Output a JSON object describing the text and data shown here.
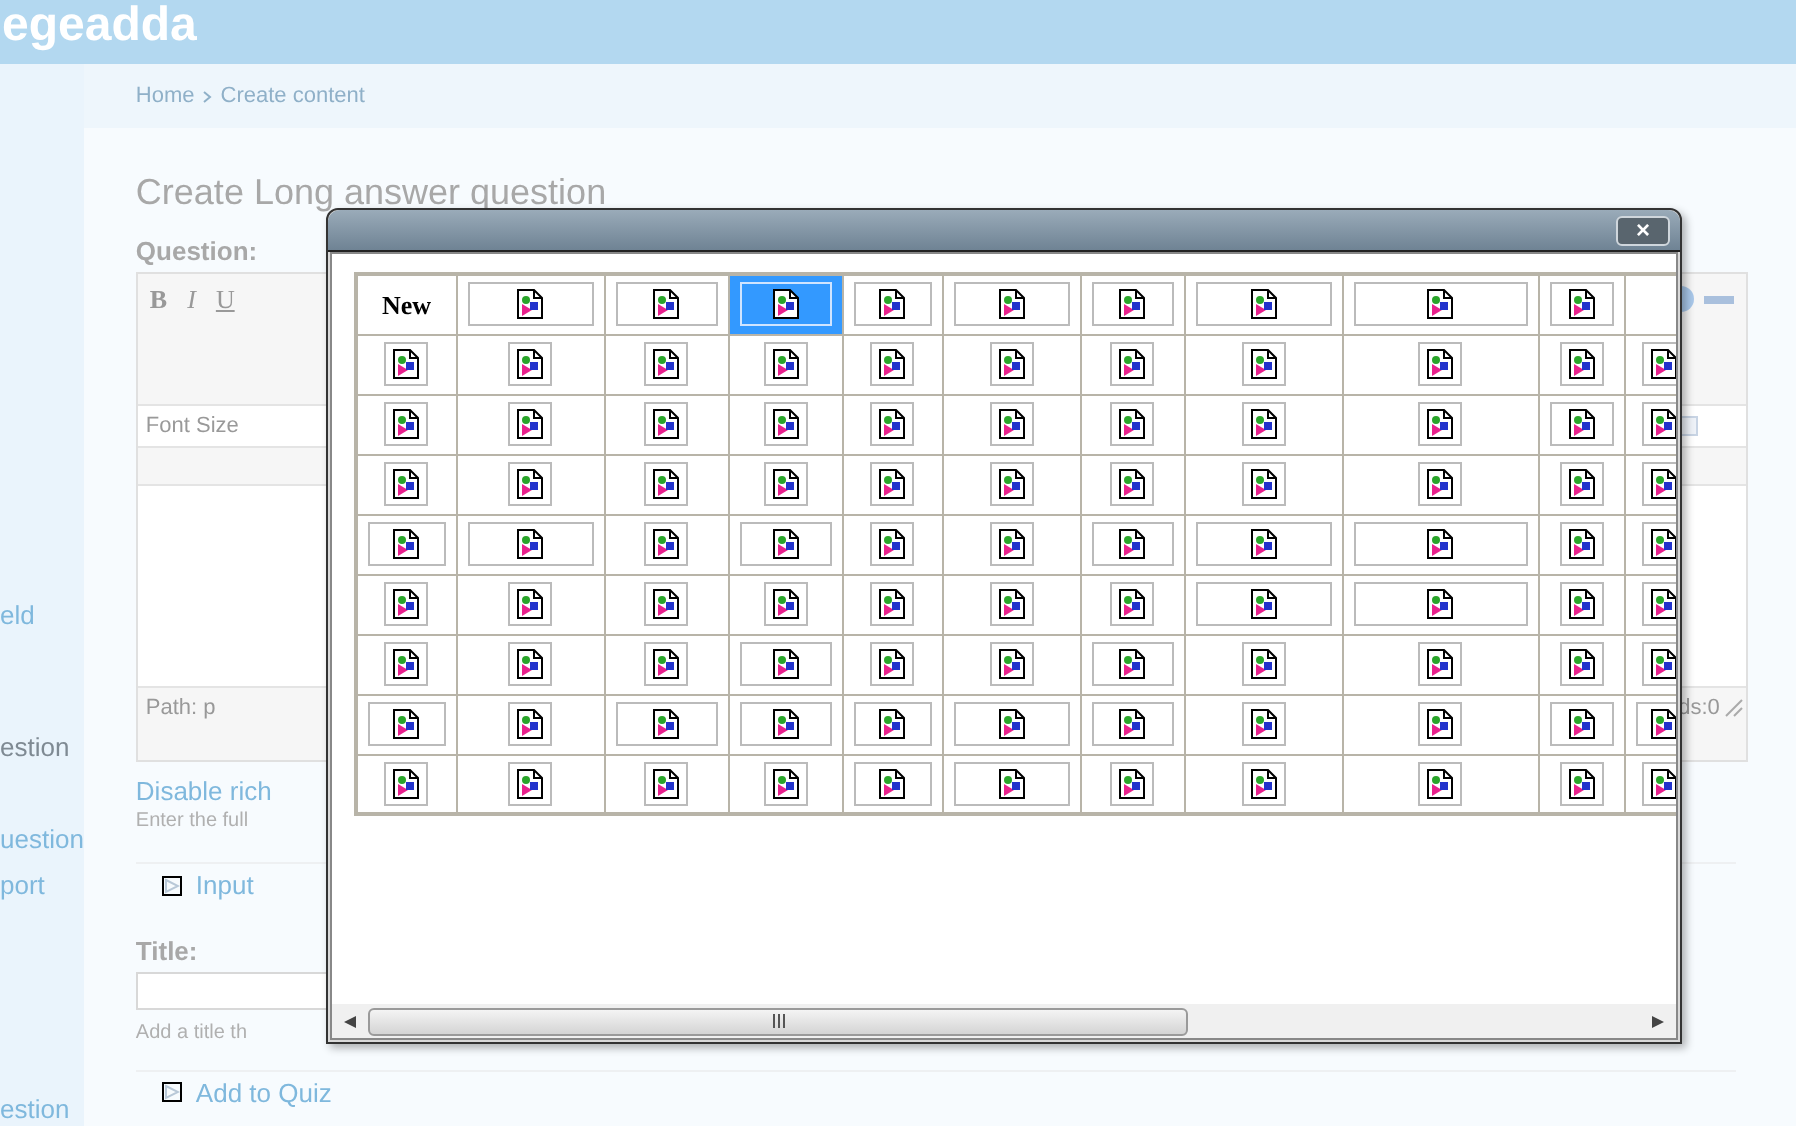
{
  "site": {
    "name": "egeadda"
  },
  "sidebar": {
    "items": [
      "eld",
      "estion",
      "uestion",
      "port",
      "estion"
    ]
  },
  "breadcrumb": [
    "Home",
    "Create content"
  ],
  "page": {
    "title": "Create Long answer question"
  },
  "question": {
    "label": "Question:",
    "toolbar": [
      "B",
      "I",
      "U"
    ],
    "font_size": "Font Size",
    "path": "Path: p",
    "word_count": "ds:0",
    "disable_link": "Disable rich",
    "hint": "Enter the full"
  },
  "input_section": {
    "legend": "Input"
  },
  "title_field": {
    "label": "Title:",
    "hint": "Add a title th"
  },
  "quiz_section": {
    "legend": "Add to Quiz"
  },
  "dialog": {
    "close": "×",
    "rows": [
      {
        "cells": [
          {
            "kind": "text",
            "label": "New",
            "selected": false
          },
          {
            "kind": "image",
            "wide": true,
            "selected": false
          },
          {
            "kind": "image",
            "wide": true,
            "selected": false
          },
          {
            "kind": "image",
            "wide": true,
            "selected": true
          },
          {
            "kind": "image",
            "wide": true,
            "selected": false
          },
          {
            "kind": "image",
            "wide": true,
            "selected": false
          },
          {
            "kind": "image",
            "wide": true,
            "selected": false
          },
          {
            "kind": "image",
            "wide": true,
            "selected": false
          },
          {
            "kind": "image",
            "wide": true,
            "selected": false
          },
          {
            "kind": "image",
            "wide": true,
            "selected": false
          }
        ]
      },
      {
        "cells": [
          {
            "kind": "image",
            "wide": false,
            "selected": false
          },
          {
            "kind": "image",
            "wide": false,
            "selected": false
          },
          {
            "kind": "image",
            "wide": false,
            "selected": false
          },
          {
            "kind": "image",
            "wide": false,
            "selected": false
          },
          {
            "kind": "image",
            "wide": false,
            "selected": false
          },
          {
            "kind": "image",
            "wide": false,
            "selected": false
          },
          {
            "kind": "image",
            "wide": false,
            "selected": false
          },
          {
            "kind": "image",
            "wide": false,
            "selected": false
          },
          {
            "kind": "image",
            "wide": false,
            "selected": false
          },
          {
            "kind": "image",
            "wide": false,
            "selected": false
          },
          {
            "kind": "image",
            "wide": false,
            "selected": false
          }
        ]
      },
      {
        "cells": [
          {
            "kind": "image",
            "wide": false,
            "selected": false
          },
          {
            "kind": "image",
            "wide": false,
            "selected": false
          },
          {
            "kind": "image",
            "wide": false,
            "selected": false
          },
          {
            "kind": "image",
            "wide": false,
            "selected": false
          },
          {
            "kind": "image",
            "wide": false,
            "selected": false
          },
          {
            "kind": "image",
            "wide": false,
            "selected": false
          },
          {
            "kind": "image",
            "wide": false,
            "selected": false
          },
          {
            "kind": "image",
            "wide": false,
            "selected": false
          },
          {
            "kind": "image",
            "wide": false,
            "selected": false
          },
          {
            "kind": "image",
            "wide": true,
            "selected": false
          },
          {
            "kind": "image",
            "wide": false,
            "selected": false
          }
        ]
      },
      {
        "cells": [
          {
            "kind": "image",
            "wide": false,
            "selected": false
          },
          {
            "kind": "image",
            "wide": false,
            "selected": false
          },
          {
            "kind": "image",
            "wide": false,
            "selected": false
          },
          {
            "kind": "image",
            "wide": false,
            "selected": false
          },
          {
            "kind": "image",
            "wide": false,
            "selected": false
          },
          {
            "kind": "image",
            "wide": false,
            "selected": false
          },
          {
            "kind": "image",
            "wide": false,
            "selected": false
          },
          {
            "kind": "image",
            "wide": false,
            "selected": false
          },
          {
            "kind": "image",
            "wide": false,
            "selected": false
          },
          {
            "kind": "image",
            "wide": false,
            "selected": false
          },
          {
            "kind": "image",
            "wide": false,
            "selected": false
          }
        ]
      },
      {
        "cells": [
          {
            "kind": "image",
            "wide": true,
            "selected": false
          },
          {
            "kind": "image",
            "wide": true,
            "selected": false
          },
          {
            "kind": "image",
            "wide": false,
            "selected": false
          },
          {
            "kind": "image",
            "wide": true,
            "selected": false
          },
          {
            "kind": "image",
            "wide": false,
            "selected": false
          },
          {
            "kind": "image",
            "wide": false,
            "selected": false
          },
          {
            "kind": "image",
            "wide": true,
            "selected": false
          },
          {
            "kind": "image",
            "wide": true,
            "selected": false
          },
          {
            "kind": "image",
            "wide": true,
            "selected": false
          },
          {
            "kind": "image",
            "wide": false,
            "selected": false
          },
          {
            "kind": "image",
            "wide": false,
            "selected": false
          }
        ]
      },
      {
        "cells": [
          {
            "kind": "image",
            "wide": false,
            "selected": false
          },
          {
            "kind": "image",
            "wide": false,
            "selected": false
          },
          {
            "kind": "image",
            "wide": false,
            "selected": false
          },
          {
            "kind": "image",
            "wide": false,
            "selected": false
          },
          {
            "kind": "image",
            "wide": false,
            "selected": false
          },
          {
            "kind": "image",
            "wide": false,
            "selected": false
          },
          {
            "kind": "image",
            "wide": false,
            "selected": false
          },
          {
            "kind": "image",
            "wide": true,
            "selected": false
          },
          {
            "kind": "image",
            "wide": true,
            "selected": false
          },
          {
            "kind": "image",
            "wide": false,
            "selected": false
          },
          {
            "kind": "image",
            "wide": false,
            "selected": false
          }
        ]
      },
      {
        "cells": [
          {
            "kind": "image",
            "wide": false,
            "selected": false
          },
          {
            "kind": "image",
            "wide": false,
            "selected": false
          },
          {
            "kind": "image",
            "wide": false,
            "selected": false
          },
          {
            "kind": "image",
            "wide": true,
            "selected": false
          },
          {
            "kind": "image",
            "wide": false,
            "selected": false
          },
          {
            "kind": "image",
            "wide": false,
            "selected": false
          },
          {
            "kind": "image",
            "wide": true,
            "selected": false
          },
          {
            "kind": "image",
            "wide": false,
            "selected": false
          },
          {
            "kind": "image",
            "wide": false,
            "selected": false
          },
          {
            "kind": "image",
            "wide": false,
            "selected": false
          },
          {
            "kind": "image",
            "wide": false,
            "selected": false
          }
        ]
      },
      {
        "cells": [
          {
            "kind": "image",
            "wide": true,
            "selected": false
          },
          {
            "kind": "image",
            "wide": false,
            "selected": false
          },
          {
            "kind": "image",
            "wide": true,
            "selected": false
          },
          {
            "kind": "image",
            "wide": true,
            "selected": false
          },
          {
            "kind": "image",
            "wide": true,
            "selected": false
          },
          {
            "kind": "image",
            "wide": true,
            "selected": false
          },
          {
            "kind": "image",
            "wide": true,
            "selected": false
          },
          {
            "kind": "image",
            "wide": false,
            "selected": false
          },
          {
            "kind": "image",
            "wide": false,
            "selected": false
          },
          {
            "kind": "image",
            "wide": true,
            "selected": false
          },
          {
            "kind": "image",
            "wide": true,
            "selected": false
          }
        ]
      },
      {
        "cells": [
          {
            "kind": "image",
            "wide": false,
            "selected": false
          },
          {
            "kind": "image",
            "wide": false,
            "selected": false
          },
          {
            "kind": "image",
            "wide": false,
            "selected": false
          },
          {
            "kind": "image",
            "wide": false,
            "selected": false
          },
          {
            "kind": "image",
            "wide": true,
            "selected": false
          },
          {
            "kind": "image",
            "wide": true,
            "selected": false
          },
          {
            "kind": "image",
            "wide": false,
            "selected": false
          },
          {
            "kind": "image",
            "wide": false,
            "selected": false
          },
          {
            "kind": "image",
            "wide": false,
            "selected": false
          },
          {
            "kind": "image",
            "wide": false,
            "selected": false
          },
          {
            "kind": "image",
            "wide": false,
            "selected": false
          }
        ]
      }
    ]
  }
}
